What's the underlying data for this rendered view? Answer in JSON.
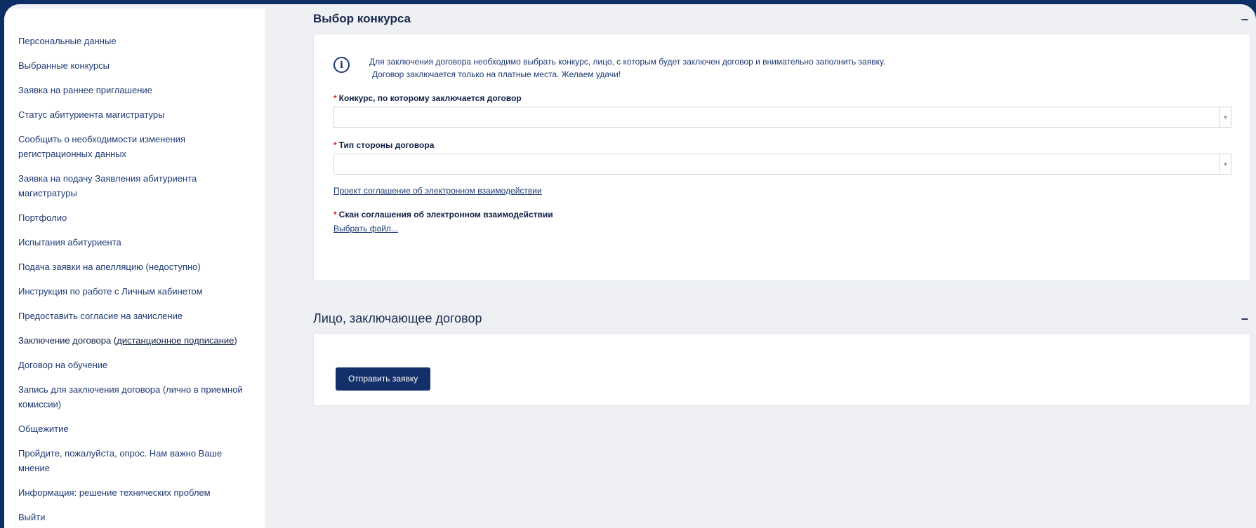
{
  "sidebar": {
    "items": [
      {
        "label": "Персональные данные"
      },
      {
        "label": "Выбранные конкурсы"
      },
      {
        "label": "Заявка на раннее приглашение"
      },
      {
        "label": "Статус абитуриента магистратуры"
      },
      {
        "label": "Сообщить о необходимости изменения регистрационных данных"
      },
      {
        "label": "Заявка на подачу Заявления абитуриента магистратуры"
      },
      {
        "label": "Портфолио"
      },
      {
        "label": "Испытания абитуриента"
      },
      {
        "label": "Подача заявки на апелляцию (недоступно)"
      },
      {
        "label": "Инструкция по работе с Личным кабинетом"
      },
      {
        "label": "Предоставить согласие на зачисление"
      },
      {
        "label_pre": "Заключение договора (",
        "label_link": "дистанционное подписание",
        "label_post": ")"
      },
      {
        "label": "Договор на обучение"
      },
      {
        "label": "Запись для заключения договора (лично в приемной комиссии)"
      },
      {
        "label": "Общежитие"
      },
      {
        "label": "Пройдите, пожалуйста, опрос. Нам важно Ваше мнение"
      },
      {
        "label": "Информация: решение технических проблем"
      },
      {
        "label": "Выйти"
      }
    ]
  },
  "section1": {
    "title": "Выбор конкурса",
    "collapse": "–",
    "info_icon": "i",
    "info_line1": "Для заключения договора необходимо выбрать конкурс, лицо, с которым будет заключен договор и внимательно заполнить заявку.",
    "info_line2": "Договор заключается только на платные места. Желаем удачи!",
    "required_mark": "*",
    "field1_label": "Конкурс, по которому заключается договор",
    "field1_value": "",
    "field2_label": "Тип стороны договора",
    "field2_value": "",
    "project_link": "Проект соглашение об электронном взаимодействии",
    "scan_label": "Скан соглашения об электронном взаимодействии",
    "choose_file": "Выбрать файл..."
  },
  "section2": {
    "title": "Лицо, заключающее договор",
    "collapse": "–",
    "submit_label": "Отправить заявку"
  },
  "colors": {
    "frame_bg": "#0d2f66",
    "accent": "#13306a",
    "arrow": "#5fb85a",
    "required": "#d0281c"
  }
}
